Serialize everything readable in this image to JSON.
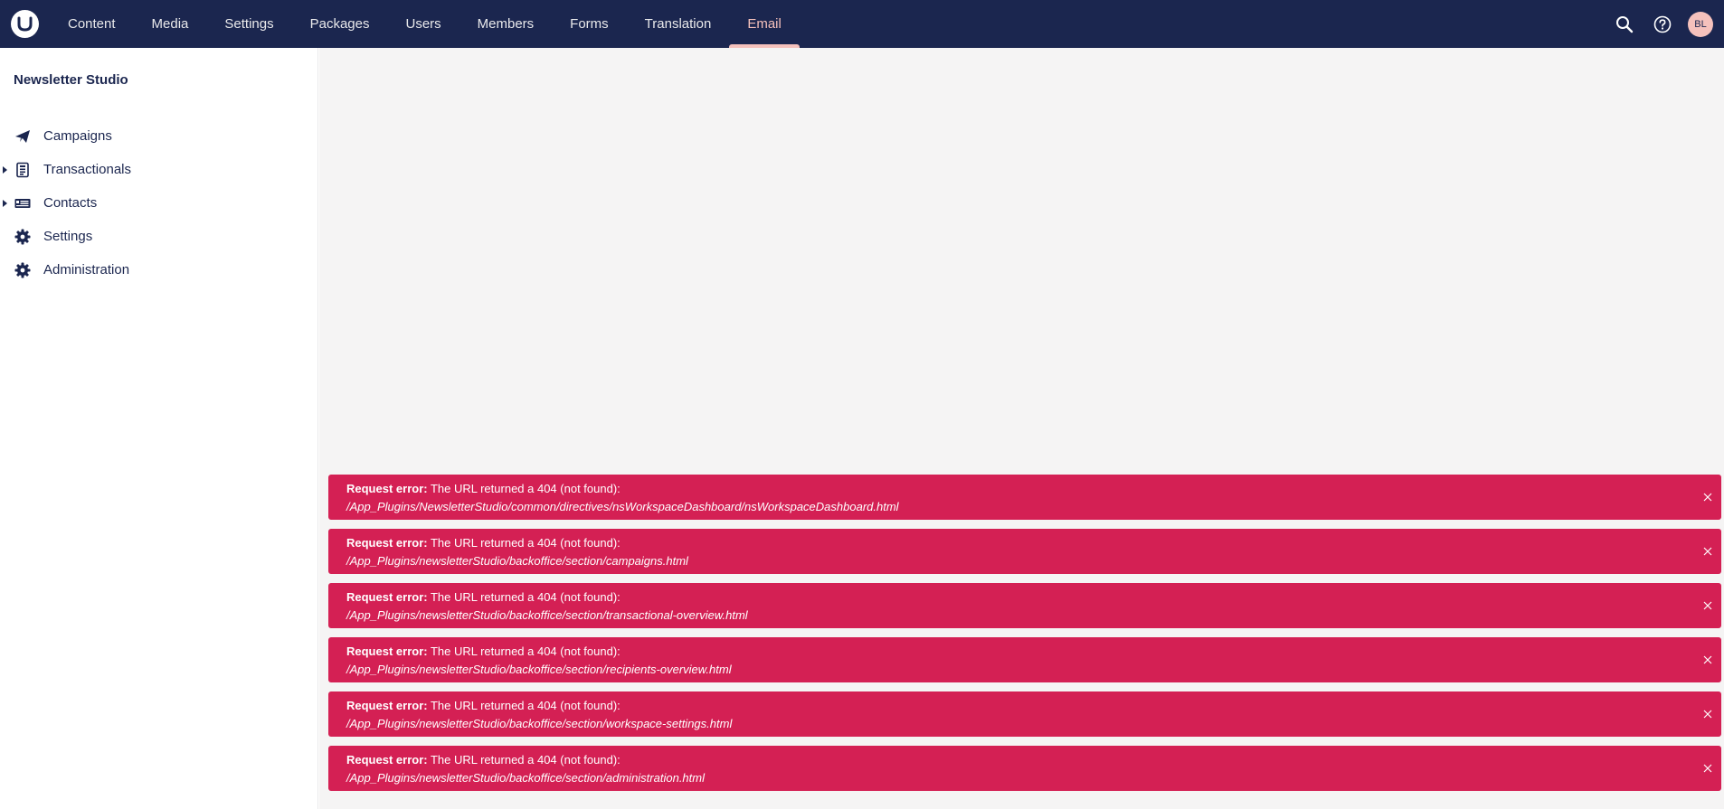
{
  "header": {
    "nav": [
      "Content",
      "Media",
      "Settings",
      "Packages",
      "Users",
      "Members",
      "Forms",
      "Translation",
      "Email"
    ],
    "active": "Email",
    "user_initials": "BL"
  },
  "icons": {
    "logo": "umbraco-logo-icon",
    "search": "search-icon",
    "help": "help-icon"
  },
  "sidebar": {
    "title": "Newsletter Studio",
    "items": [
      {
        "label": "Campaigns",
        "icon": "paper-plane-icon",
        "expandable": false
      },
      {
        "label": "Transactionals",
        "icon": "receipt-icon",
        "expandable": true
      },
      {
        "label": "Contacts",
        "icon": "contact-card-icon",
        "expandable": true
      },
      {
        "label": "Settings",
        "icon": "gear-icon",
        "expandable": false
      },
      {
        "label": "Administration",
        "icon": "gear-icon",
        "expandable": false
      }
    ]
  },
  "notifications": [
    {
      "prefix": "Request error:",
      "message": " The URL returned a 404 (not found):",
      "path": "/App_Plugins/NewsletterStudio/common/directives/nsWorkspaceDashboard/nsWorkspaceDashboard.html"
    },
    {
      "prefix": "Request error:",
      "message": " The URL returned a 404 (not found):",
      "path": "/App_Plugins/newsletterStudio/backoffice/section/campaigns.html"
    },
    {
      "prefix": "Request error:",
      "message": " The URL returned a 404 (not found):",
      "path": "/App_Plugins/newsletterStudio/backoffice/section/transactional-overview.html"
    },
    {
      "prefix": "Request error:",
      "message": " The URL returned a 404 (not found):",
      "path": "/App_Plugins/newsletterStudio/backoffice/section/recipients-overview.html"
    },
    {
      "prefix": "Request error:",
      "message": " The URL returned a 404 (not found):",
      "path": "/App_Plugins/newsletterStudio/backoffice/section/workspace-settings.html"
    },
    {
      "prefix": "Request error:",
      "message": " The URL returned a 404 (not found):",
      "path": "/App_Plugins/newsletterStudio/backoffice/section/administration.html"
    }
  ],
  "colors": {
    "header_bg": "#1b264f",
    "active_accent": "#f5c1bc",
    "error_bg": "#d42054",
    "main_bg": "#f5f4f4"
  }
}
